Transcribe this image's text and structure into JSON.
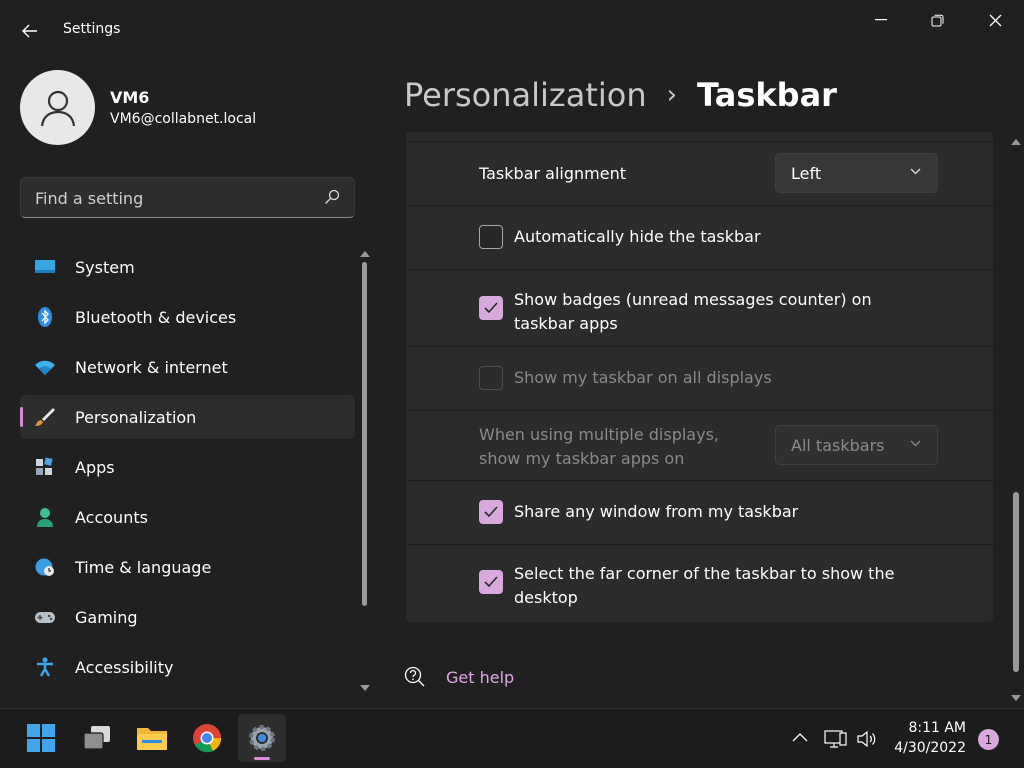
{
  "window": {
    "title": "Settings",
    "icons": {
      "back": "back-arrow-icon",
      "minimize": "minimize-icon",
      "maximize": "restore-icon",
      "close": "close-icon"
    }
  },
  "profile": {
    "name": "VM6",
    "email": "VM6@collabnet.local",
    "icon": "person-icon"
  },
  "search": {
    "placeholder": "Find a setting",
    "icon": "search-icon"
  },
  "sidebar": {
    "items": [
      {
        "label": "System",
        "icon": "monitor-icon",
        "selected": false
      },
      {
        "label": "Bluetooth & devices",
        "icon": "bluetooth-icon",
        "selected": false
      },
      {
        "label": "Network & internet",
        "icon": "wifi-icon",
        "selected": false
      },
      {
        "label": "Personalization",
        "icon": "brush-icon",
        "selected": true
      },
      {
        "label": "Apps",
        "icon": "apps-icon",
        "selected": false
      },
      {
        "label": "Accounts",
        "icon": "account-icon",
        "selected": false
      },
      {
        "label": "Time & language",
        "icon": "globe-clock-icon",
        "selected": false
      },
      {
        "label": "Gaming",
        "icon": "gamepad-icon",
        "selected": false
      },
      {
        "label": "Accessibility",
        "icon": "accessibility-icon",
        "selected": false
      }
    ]
  },
  "breadcrumb": {
    "parent": "Personalization",
    "separator": "›",
    "current": "Taskbar"
  },
  "settings": {
    "alignment": {
      "label": "Taskbar alignment",
      "value": "Left"
    },
    "auto_hide": {
      "label": "Automatically hide the taskbar",
      "checked": false
    },
    "badges": {
      "label": "Show badges (unread messages counter) on taskbar apps",
      "checked": true
    },
    "all_displays": {
      "label": "Show my taskbar on all displays",
      "checked": false,
      "disabled": true
    },
    "multi_display": {
      "label": "When using multiple displays, show my taskbar apps on",
      "value": "All taskbars",
      "disabled": true
    },
    "share_window": {
      "label": "Share any window from my taskbar",
      "checked": true
    },
    "far_corner": {
      "label": "Select the far corner of the taskbar to show the desktop",
      "checked": true
    }
  },
  "help": {
    "label": "Get help",
    "icon": "help-chat-icon"
  },
  "taskbar": {
    "apps": [
      {
        "name": "start",
        "icon": "windows-logo-icon"
      },
      {
        "name": "task-view",
        "icon": "task-view-icon"
      },
      {
        "name": "file-explorer",
        "icon": "folder-icon"
      },
      {
        "name": "chrome",
        "icon": "chrome-icon"
      },
      {
        "name": "settings",
        "icon": "gear-icon",
        "active": true
      }
    ],
    "tray_icons": [
      "chevron-up-icon",
      "network-icon",
      "volume-icon"
    ],
    "time": "8:11 AM",
    "date": "4/30/2022",
    "notifications": "1"
  },
  "colors": {
    "accent": "#d9a8de",
    "accent_indicator": "#d98ad8",
    "background": "#202020",
    "card": "#2b2b2b"
  }
}
